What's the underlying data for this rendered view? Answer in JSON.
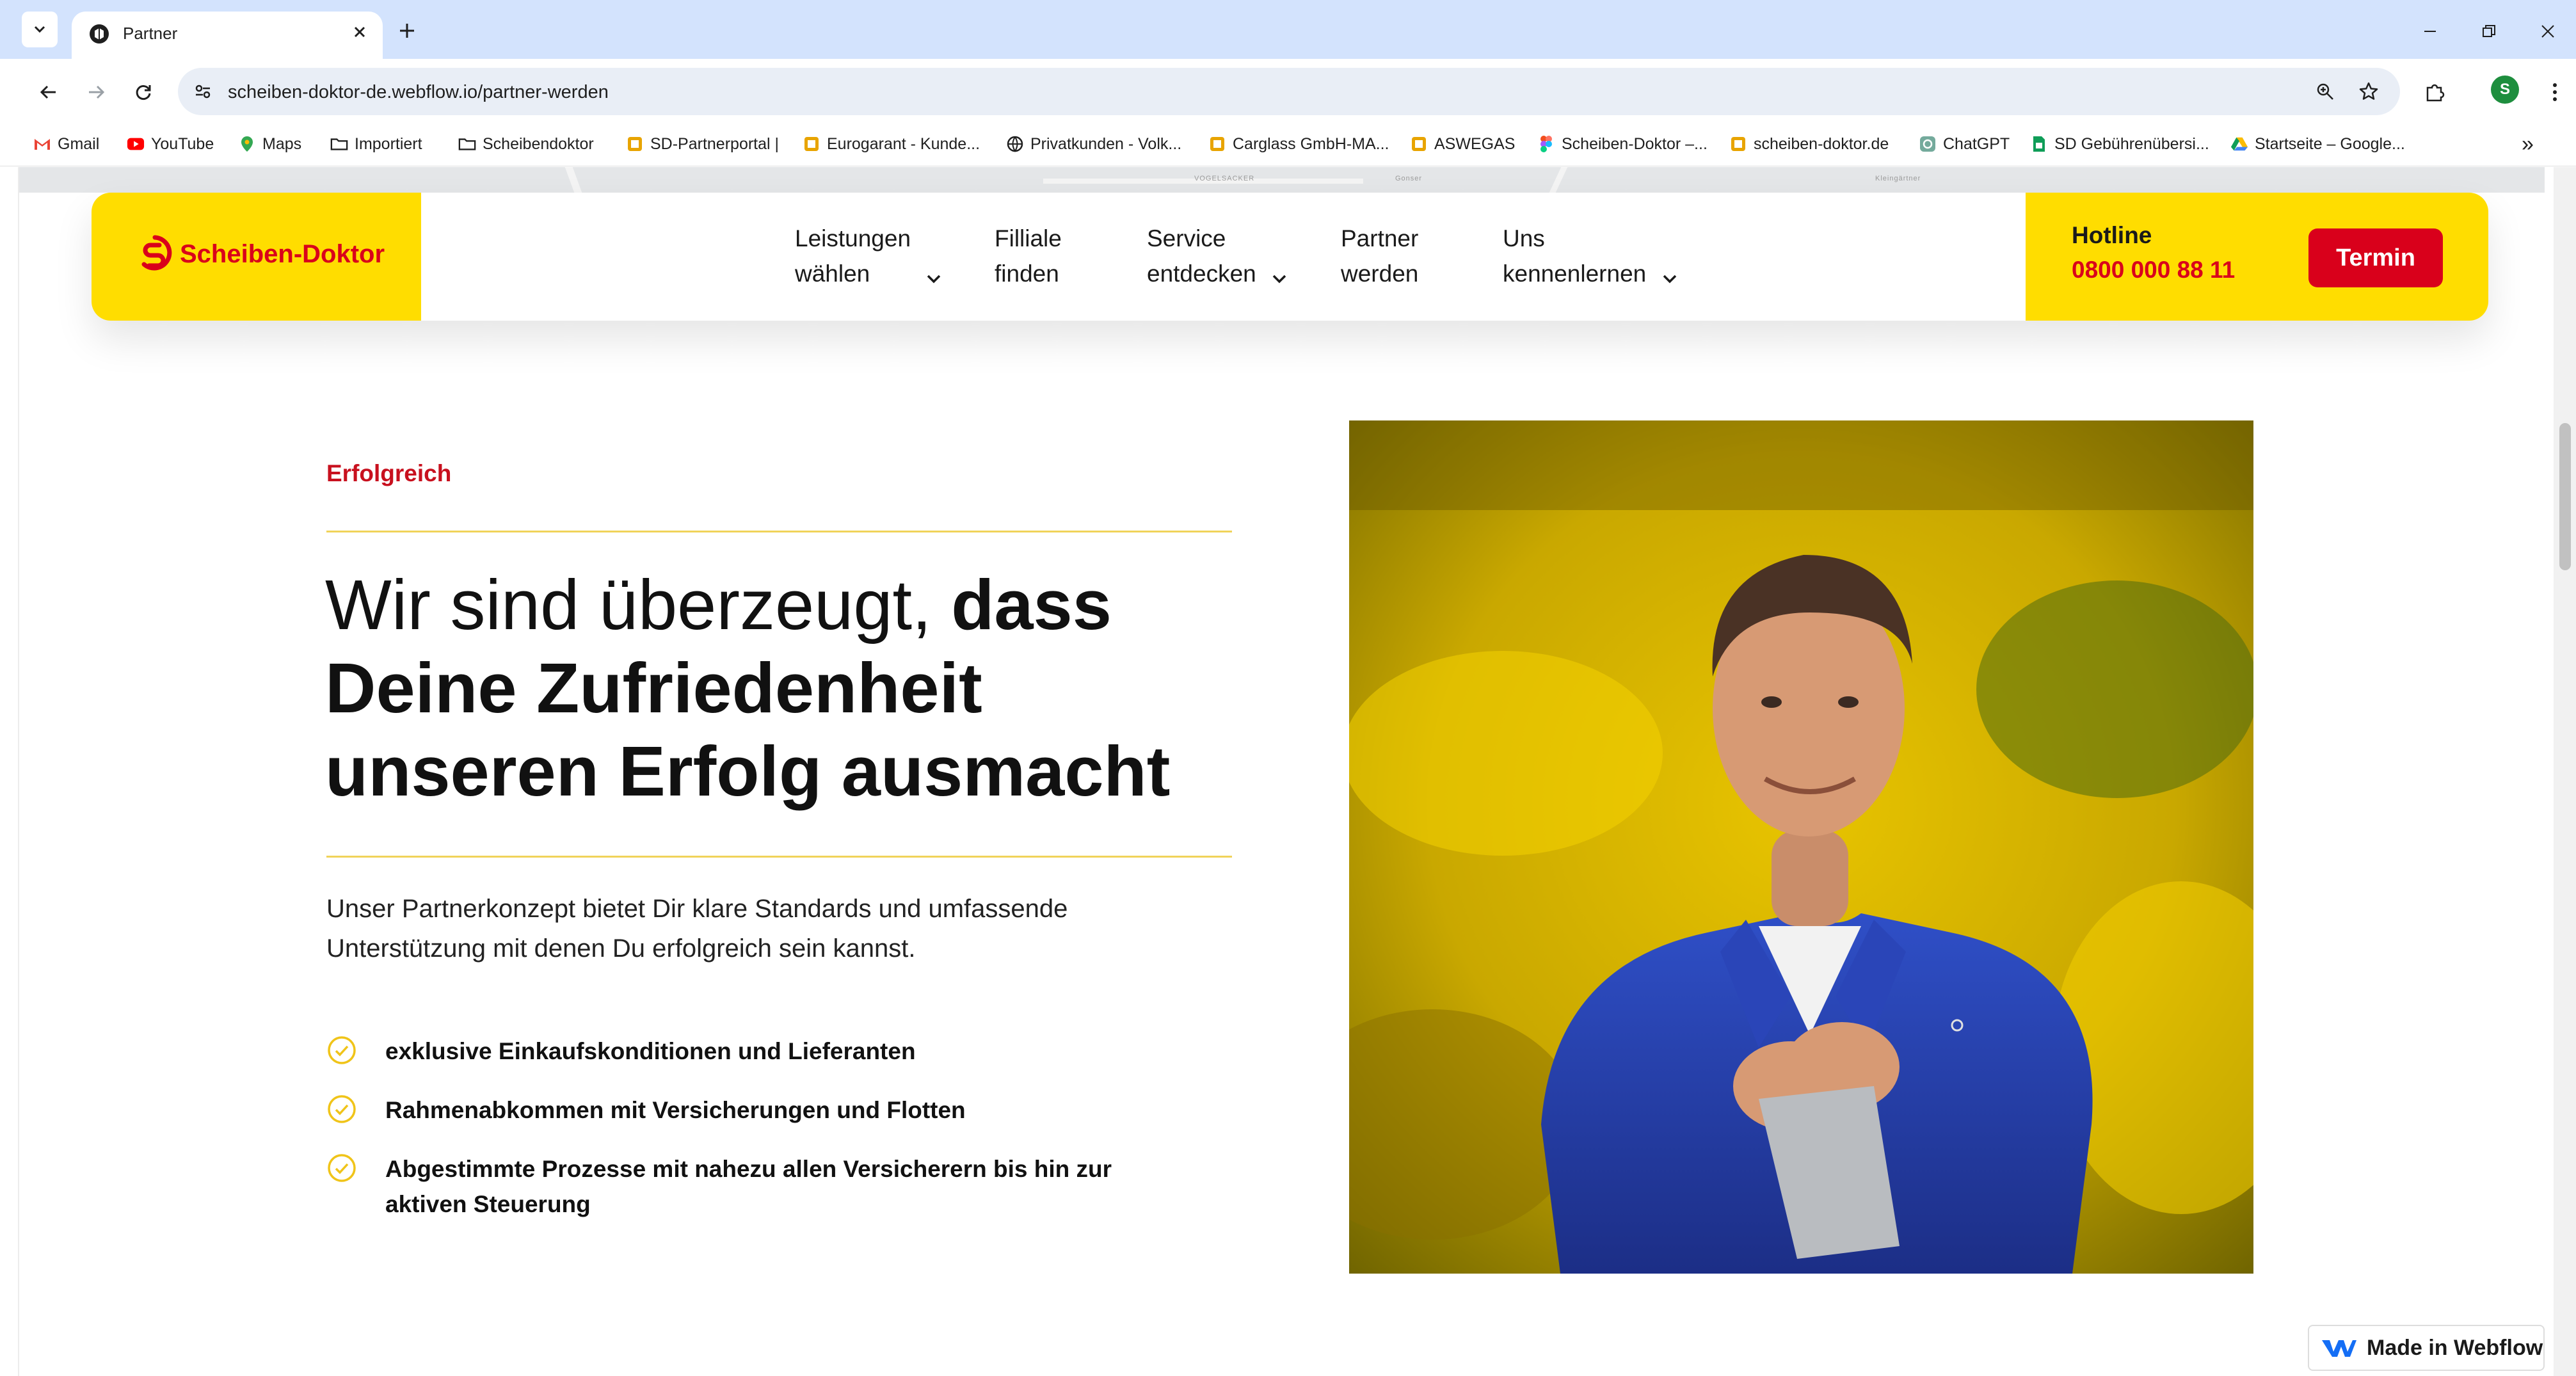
{
  "browser": {
    "tab_title": "Partner",
    "url": "scheiben-doktor-de.webflow.io/partner-werden",
    "profile_initial": "S",
    "bookmarks": [
      {
        "label": "Gmail",
        "icon": "gmail-icon"
      },
      {
        "label": "YouTube",
        "icon": "youtube-icon"
      },
      {
        "label": "Maps",
        "icon": "maps-icon"
      },
      {
        "label": "Importiert",
        "icon": "folder-icon"
      },
      {
        "label": "Scheibendoktor",
        "icon": "folder-icon"
      },
      {
        "label": "SD-Partnerportal |",
        "icon": "site-icon"
      },
      {
        "label": "Eurogarant - Kunde...",
        "icon": "site-icon"
      },
      {
        "label": "Privatkunden - Volk...",
        "icon": "globe-icon"
      },
      {
        "label": "Carglass GmbH-MA...",
        "icon": "site-icon"
      },
      {
        "label": "ASWEGAS",
        "icon": "site-icon"
      },
      {
        "label": "Scheiben-Doktor –...",
        "icon": "figma-icon"
      },
      {
        "label": "scheiben-doktor.de",
        "icon": "site-icon"
      },
      {
        "label": "ChatGPT",
        "icon": "chatgpt-icon"
      },
      {
        "label": "SD Gebührenübersi...",
        "icon": "sheets-icon"
      },
      {
        "label": "Startseite – Google...",
        "icon": "drive-icon"
      }
    ],
    "bookmarks_overflow": "»"
  },
  "map_labels": [
    "VOGELSACKER",
    "Gonser",
    "Kleingärtner"
  ],
  "nav": {
    "logo_text": "Scheiben-Doktor",
    "items": [
      {
        "line1": "Leistungen",
        "line2": "wählen"
      },
      {
        "line1": "Filliale",
        "line2": "finden"
      },
      {
        "line1": "Service",
        "line2": "entdecken"
      },
      {
        "line1": "Partner",
        "line2": "werden"
      },
      {
        "line1": "Uns",
        "line2": "kennenlernen"
      }
    ],
    "hotline_label": "Hotline",
    "hotline_number": "0800 000 88 11",
    "cta_label": "Termin"
  },
  "content": {
    "eyebrow": "Erfolgreich",
    "headline_part1": "Wir sind überzeugt, ",
    "headline_part2": "dass Deine Zufriedenheit unseren Erfolg ausmacht",
    "intro": "Unser Partnerkonzept bietet Dir klare Standards und umfassende Unterstützung mit denen Du erfolgreich sein kannst.",
    "features": [
      "exklusive Einkaufskonditionen und Lieferanten",
      "Rahmenabkommen mit Versicherungen und Flotten",
      "Abgestimmte Prozesse mit nahezu allen Versicherern bis hin zur aktiven Steuerung"
    ]
  },
  "badge": {
    "label": "Made in Webflow"
  },
  "colors": {
    "brand_yellow": "#ffdd00",
    "brand_red": "#d9001b",
    "rule_yellow": "#f0d35a"
  }
}
